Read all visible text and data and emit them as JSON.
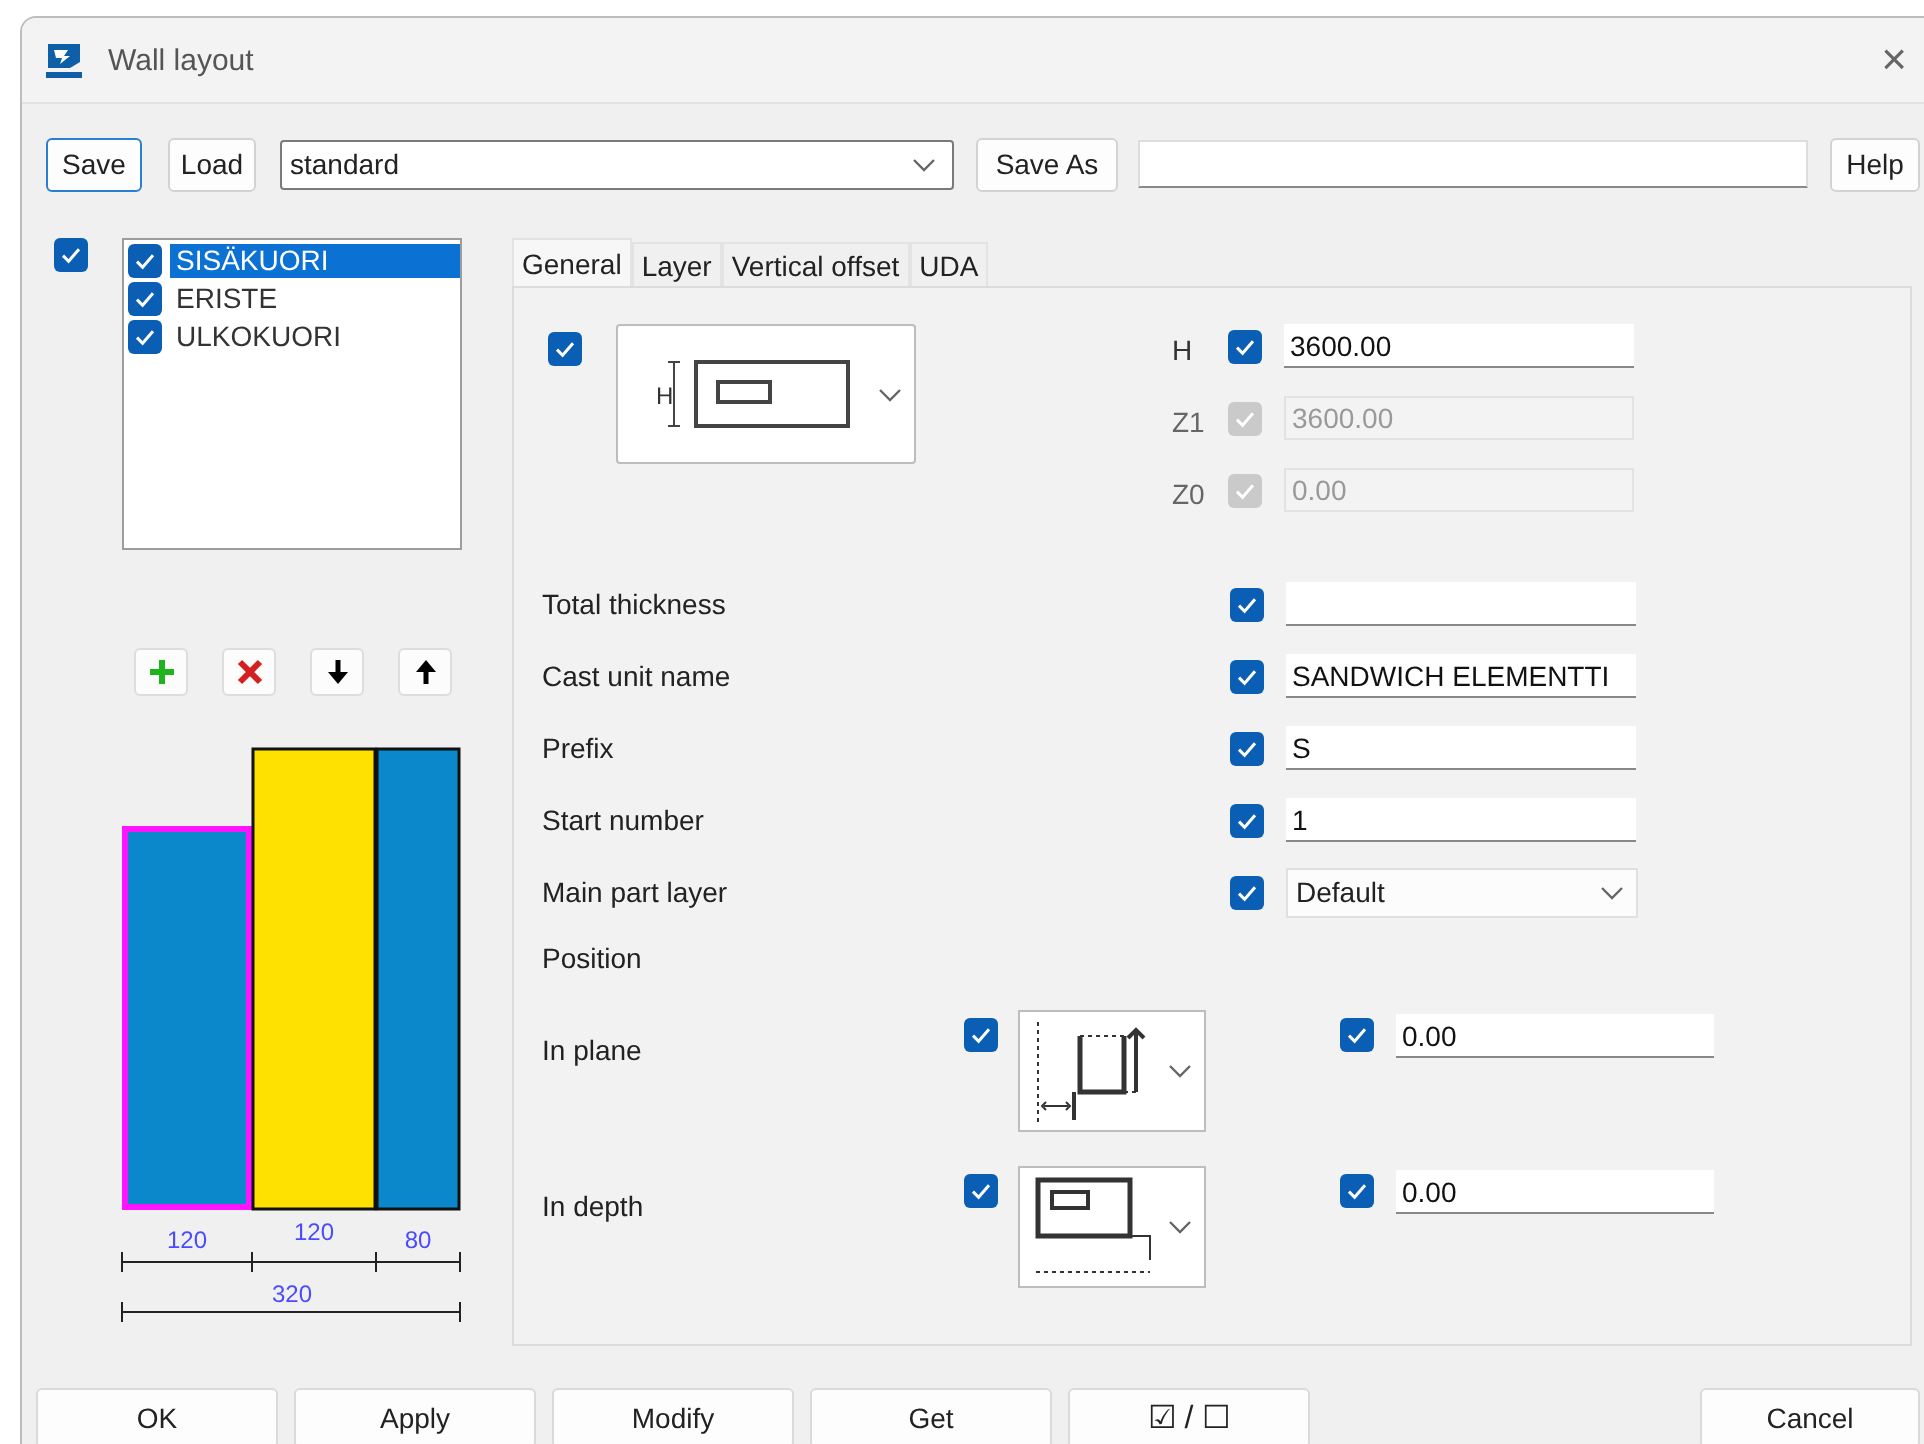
{
  "window": {
    "title": "Wall layout",
    "close": "×"
  },
  "toolbar": {
    "save": "Save",
    "load": "Load",
    "preset": "standard",
    "save_as": "Save As",
    "help": "Help"
  },
  "layers": {
    "all_checked": true,
    "items": [
      {
        "name": "SISÄKUORI",
        "checked": true,
        "selected": true
      },
      {
        "name": "ERISTE",
        "checked": true,
        "selected": false
      },
      {
        "name": "ULKOKUORI",
        "checked": true,
        "selected": false
      }
    ]
  },
  "section": {
    "segments": [
      {
        "label": "120",
        "color": "#0b87cc",
        "kind": "low",
        "selected": true
      },
      {
        "label": "120",
        "color": "#ffe100",
        "kind": "full",
        "selected": false
      },
      {
        "label": "80",
        "color": "#0b87cc",
        "kind": "full",
        "selected": false
      }
    ],
    "total": "320"
  },
  "tabs": [
    {
      "label": "General",
      "selected": true
    },
    {
      "label": "Layer",
      "selected": false
    },
    {
      "label": "Vertical offset",
      "selected": false
    },
    {
      "label": "UDA",
      "selected": false
    }
  ],
  "general": {
    "shape": {
      "checked": true,
      "dimension_label": "H"
    },
    "levels": [
      {
        "label": "H",
        "checked": true,
        "disabled": false,
        "value": "3600.00"
      },
      {
        "label": "Z1",
        "checked": true,
        "disabled": true,
        "value": "3600.00"
      },
      {
        "label": "Z0",
        "checked": true,
        "disabled": true,
        "value": "0.00"
      }
    ],
    "properties": [
      {
        "label": "Total thickness",
        "checked": true,
        "kind": "text"
      },
      {
        "label": "Cast unit name",
        "checked": true,
        "kind": "text",
        "value": "SANDWICH ELEMENTTI"
      },
      {
        "label": "Prefix",
        "checked": true,
        "kind": "text",
        "value": "S"
      },
      {
        "label": "Start number",
        "checked": true,
        "kind": "text",
        "value": "1"
      },
      {
        "label": "Main part layer",
        "checked": true,
        "kind": "dropdown",
        "value": "Default"
      }
    ],
    "position": {
      "title": "Position",
      "rows": [
        {
          "label": "In plane",
          "kind": "plane",
          "checked": true,
          "value_checked": true,
          "value": "0.00"
        },
        {
          "label": "In depth",
          "kind": "depth",
          "checked": true,
          "value_checked": true,
          "value": "0.00"
        }
      ]
    }
  },
  "buttons": [
    {
      "label": "OK",
      "kind": "push"
    },
    {
      "label": "Apply",
      "kind": "push"
    },
    {
      "label": "Modify",
      "kind": "push"
    },
    {
      "label": "Get",
      "kind": "push"
    },
    {
      "label": "☑ / ☐",
      "kind": "toggle"
    },
    {
      "label": "Cancel",
      "kind": "cancel"
    }
  ]
}
